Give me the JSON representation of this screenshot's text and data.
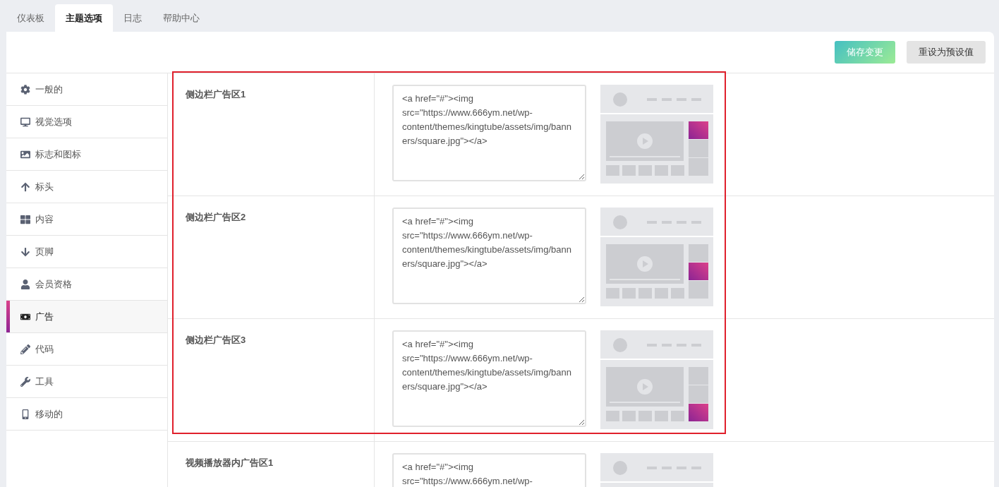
{
  "tabs": [
    {
      "label": "仪表板",
      "selected": false
    },
    {
      "label": "主题选项",
      "selected": true
    },
    {
      "label": "日志",
      "selected": false
    },
    {
      "label": "帮助中心",
      "selected": false
    }
  ],
  "toolbar": {
    "buttons": [
      {
        "label": "储存变更",
        "kind": "primary"
      },
      {
        "label": "重设为预设值",
        "kind": "secondary"
      }
    ]
  },
  "sidebar": {
    "items": [
      {
        "label": "一般的",
        "selected": false
      },
      {
        "label": "视觉选项",
        "selected": false
      },
      {
        "label": "标志和图标",
        "selected": false
      },
      {
        "label": "标头",
        "selected": false
      },
      {
        "label": "内容",
        "selected": false
      },
      {
        "label": "页脚",
        "selected": false
      },
      {
        "label": "会员资格",
        "selected": false
      },
      {
        "label": "广告",
        "selected": true
      },
      {
        "label": "代码",
        "selected": false
      },
      {
        "label": "工具",
        "selected": false
      },
      {
        "label": "移动的",
        "selected": false
      }
    ]
  },
  "settings": [
    {
      "label": "侧边栏广告区1",
      "value": "<a href=\"#\"><img src=\"https://www.666ym.net/wp-content/themes/kingtube/assets/img/banners/square.jpg\"></a>",
      "ad_slots": [
        {
          "selected": true
        },
        {
          "selected": false
        },
        {
          "selected": false
        }
      ]
    },
    {
      "label": "侧边栏广告区2",
      "value": "<a href=\"#\"><img src=\"https://www.666ym.net/wp-content/themes/kingtube/assets/img/banners/square.jpg\"></a>",
      "ad_slots": [
        {
          "selected": false
        },
        {
          "selected": true
        },
        {
          "selected": false
        }
      ]
    },
    {
      "label": "侧边栏广告区3",
      "value": "<a href=\"#\"><img src=\"https://www.666ym.net/wp-content/themes/kingtube/assets/img/banners/square.jpg\"></a>",
      "ad_slots": [
        {
          "selected": false
        },
        {
          "selected": false
        },
        {
          "selected": true
        }
      ]
    },
    {
      "label": "视频播放器内广告区1",
      "value": "<a href=\"#\"><img src=\"https://www.666ym.net/wp-"
    }
  ]
}
